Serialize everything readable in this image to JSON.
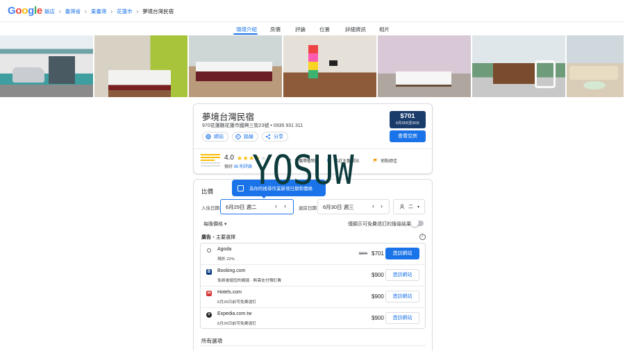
{
  "topbar": {
    "logo_text": "Google",
    "breadcrumb": [
      "飯店",
      "臺灣省",
      "東臺灣",
      "花蓮市",
      "夢境台灣民宿"
    ]
  },
  "tabs": [
    "環境介紹",
    "房價",
    "評論",
    "位置",
    "詳細資訊",
    "相片"
  ],
  "active_tab": "環境介紹",
  "hotel": {
    "name": "夢境台灣民宿",
    "address": "970花蓮縣花蓮市國興三街23號 • 0935 931 311",
    "chips": [
      "網站",
      "路線",
      "分享"
    ],
    "price": "$701",
    "price_dates": "6月29日至30日",
    "check_button": "查看空房",
    "rating": "4.0",
    "stars_filled": 4,
    "rating_word": "很好",
    "reviews_link": "86 則評論",
    "amenities": [
      "可攜帶寵物",
      "靠近太魯閣站",
      "地點絕佳"
    ]
  },
  "prices": {
    "title": "比價",
    "tooltip": "為你的搜尋作業新增日期和價格",
    "checkin_label": "入住日期",
    "checkin_value": "6月29日 週二",
    "checkout_label": "退房日期",
    "checkout_value": "6月30日 週三",
    "guests_value": "二",
    "nightly_label": "每晚價格",
    "free_cancel_label": "僅顯示可免費退訂的搜尋結果",
    "ads_prefix": "廣告",
    "ads_suffix": "・主要選擇",
    "offers": [
      {
        "name": "Agoda",
        "sub": "現折 22%",
        "old_price": "$899",
        "price": "$701",
        "button": "造訪網站",
        "primary": true,
        "logo_color": "#ffffff",
        "logo_char": "○"
      },
      {
        "name": "Booking.com",
        "sub": "免將會銷您的網頁 · 無需支付預訂費",
        "old_price": "",
        "price": "$900",
        "button": "造訪網站",
        "primary": false,
        "logo_color": "#003580",
        "logo_char": "B"
      },
      {
        "name": "Hotels.com",
        "sub": "6月26日前可免費退訂",
        "old_price": "",
        "price": "$900",
        "button": "造訪網站",
        "primary": false,
        "logo_color": "#d32f2f",
        "logo_char": "H"
      },
      {
        "name": "Expedia.com.tw",
        "sub": "6月26日前可免費退訂",
        "old_price": "",
        "price": "$900",
        "button": "造訪網站",
        "primary": false,
        "logo_color": "#202124",
        "logo_char": "✈"
      }
    ],
    "all_options_label": "所有選項"
  },
  "watermark": "YOSUW",
  "colors": {
    "accent": "#1a73e8",
    "price_box": "#1a3c6b",
    "star": "#fbbc04"
  }
}
